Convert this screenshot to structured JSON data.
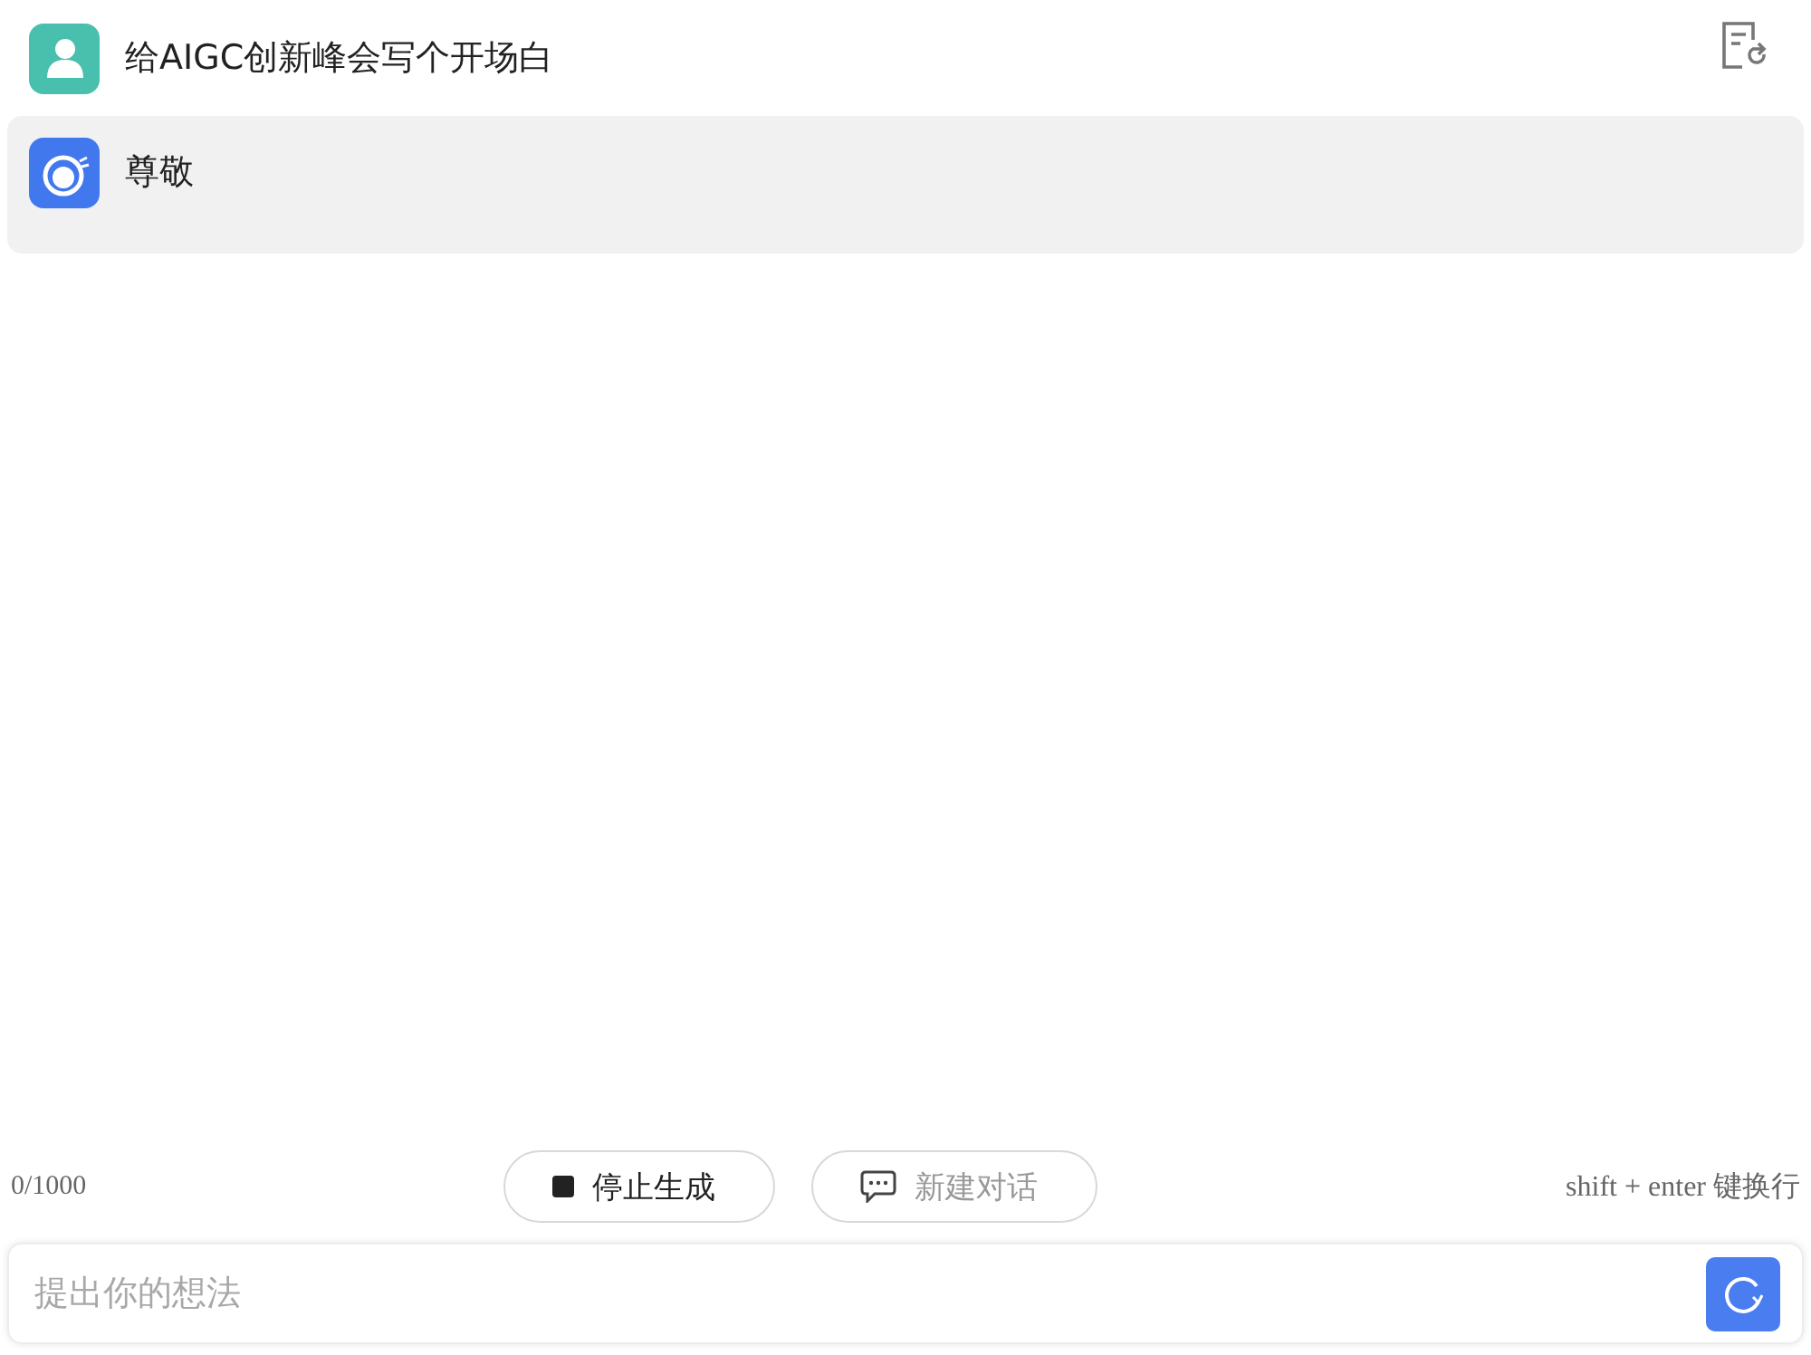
{
  "messages": [
    {
      "kind": "user",
      "text": "给AIGC创新峰会写个开场白"
    },
    {
      "kind": "assistant",
      "text": "尊敬"
    }
  ],
  "counter": "0/1000",
  "actions": [
    {
      "kind": "stop",
      "label": "停止生成",
      "disabled": false
    },
    {
      "kind": "new",
      "label": "新建对话",
      "disabled": true
    }
  ],
  "hint": "shift + enter 键换行",
  "input": {
    "placeholder": "提出你的想法"
  }
}
